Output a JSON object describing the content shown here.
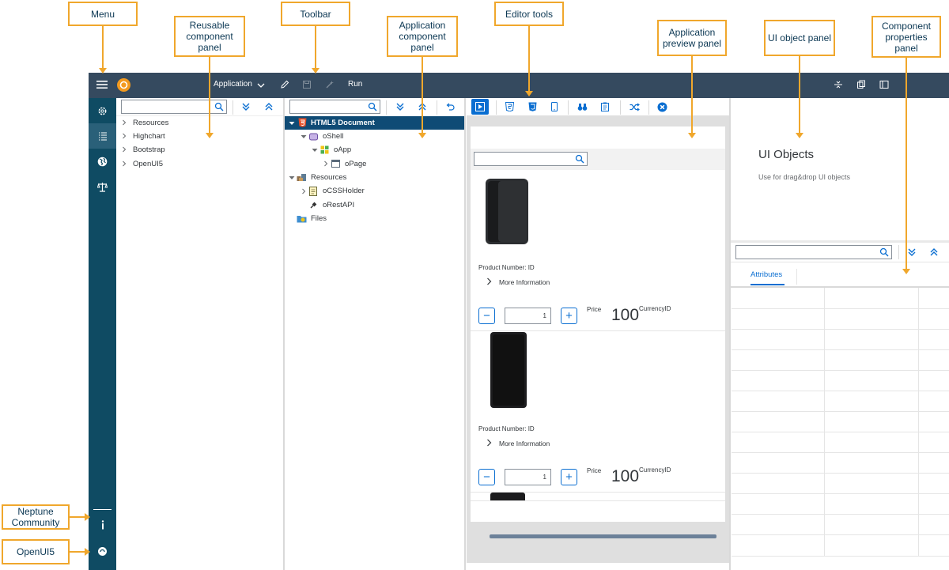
{
  "callouts": {
    "menu": "Menu",
    "reusable": "Reusable component panel",
    "toolbar": "Toolbar",
    "app_component": "Application component panel",
    "editor_tools": "Editor tools",
    "app_preview": "Application preview panel",
    "ui_object": "UI object panel",
    "component_props": "Component properties panel",
    "neptune": "Neptune Community",
    "openui5": "OpenUI5"
  },
  "shellbar": {
    "application_label": "Application",
    "run_label": "Run"
  },
  "reusable_panel": {
    "search_placeholder": "",
    "items": [
      "Resources",
      "Highchart",
      "Bootstrap",
      "OpenUI5"
    ]
  },
  "app_tree": {
    "search_placeholder": "",
    "nodes": [
      "HTML5 Document",
      "oShell",
      "oApp",
      "oPage",
      "Resources",
      "oCSSHolder",
      "oRestAPI",
      "Files"
    ]
  },
  "preview": {
    "search_placeholder": "",
    "products": [
      {
        "number_label": "Product Number: ID",
        "more_info": "More Information",
        "qty": "1",
        "price_label": "Price",
        "price": "100",
        "currency": "CurrencyID"
      },
      {
        "number_label": "Product Number: ID",
        "more_info": "More Information",
        "qty": "1",
        "price_label": "Price",
        "price": "100",
        "currency": "CurrencyID"
      }
    ]
  },
  "ui_objects": {
    "title": "UI Objects",
    "hint": "Use for drag&drop UI objects"
  },
  "properties": {
    "search_placeholder": "",
    "tab": "Attributes"
  },
  "colors": {
    "shellbar": "#354a5f",
    "sidenav": "#0f4b63",
    "accent": "#0a6ed1",
    "callout_border": "#f0a72c",
    "tree_selected": "#0f4b75"
  }
}
